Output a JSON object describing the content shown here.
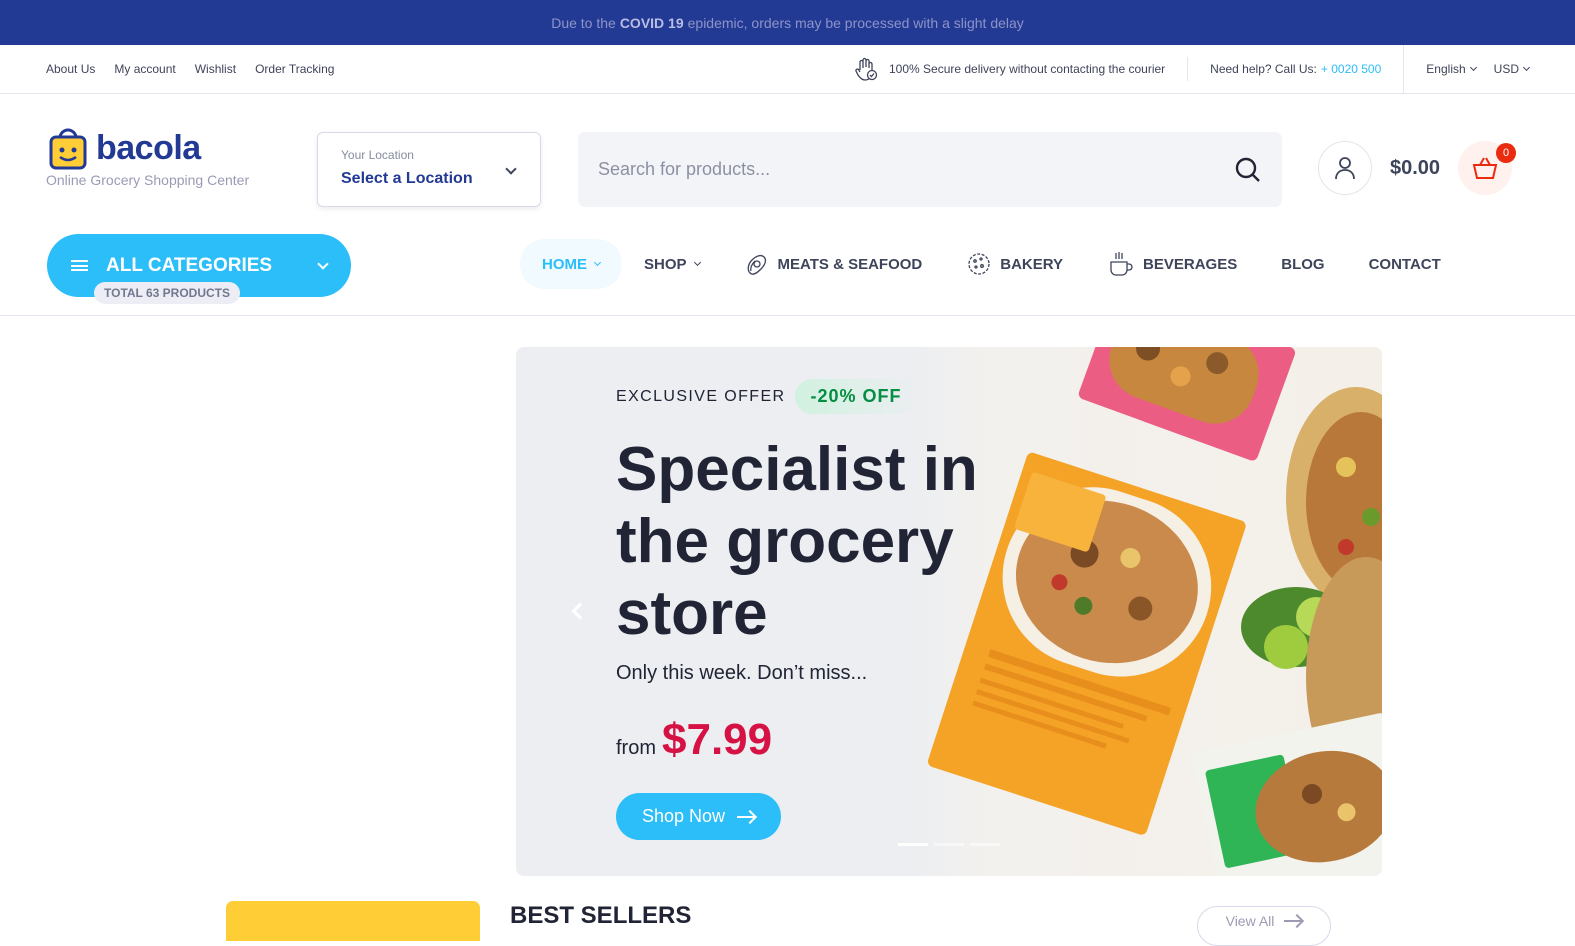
{
  "notice": {
    "prefix": "Due to the",
    "highlight": "COVID 19",
    "suffix": "epidemic, orders may be processed with a slight delay"
  },
  "topbar": {
    "links": [
      "About Us",
      "My account",
      "Wishlist",
      "Order Tracking"
    ],
    "secure_text": "100% Secure delivery without contacting the courier",
    "help_text": "Need help? Call Us:",
    "phone": "+ 0020 500",
    "language": "English",
    "currency": "USD"
  },
  "header": {
    "logo_text": "bacola",
    "tagline": "Online Grocery Shopping Center",
    "location_label": "Your Location",
    "location_value": "Select a Location",
    "search_placeholder": "Search for products...",
    "cart_total": "$0.00",
    "cart_count": "0"
  },
  "nav": {
    "all_categories": "ALL CATEGORIES",
    "total_products": "TOTAL 63 PRODUCTS",
    "items": [
      "HOME",
      "SHOP",
      "MEATS & SEAFOOD",
      "BAKERY",
      "BEVERAGES",
      "BLOG",
      "CONTACT"
    ]
  },
  "hero": {
    "offer_label": "EXCLUSIVE OFFER",
    "offer_badge": "-20% OFF",
    "title": "Specialist in the grocery store",
    "subtitle": "Only this week. Don’t miss...",
    "from": "from",
    "price": "$7.99",
    "cta": "Shop Now"
  },
  "sections": {
    "best_sellers": "BEST SELLERS",
    "view_all": "View All"
  },
  "colors": {
    "brand_blue": "#233a95",
    "accent": "#2bbef9",
    "price_red": "#d51243",
    "badge_green": "#038e42"
  }
}
